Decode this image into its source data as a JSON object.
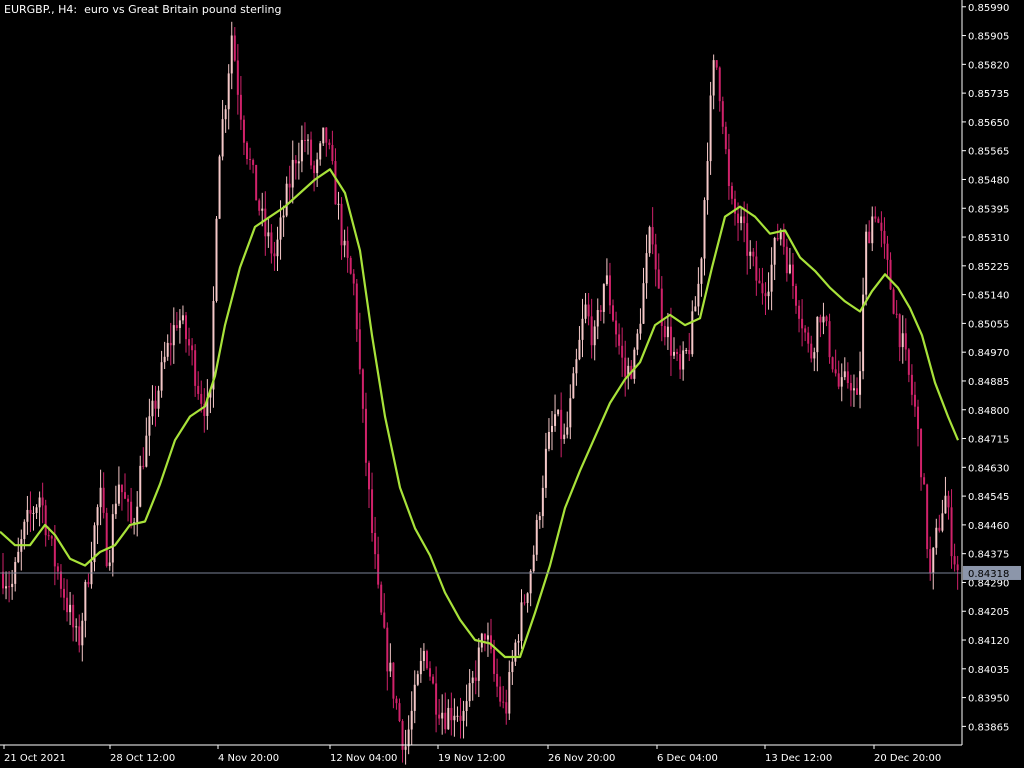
{
  "header": {
    "symbol": "EURGBP.,",
    "timeframe": "H4:",
    "description": "euro vs Great Britain pound sterling"
  },
  "colors": {
    "background": "#000000",
    "axis": "#ffffff",
    "bull_candle": "#f5c8c8",
    "bear_candle": "#d0226a",
    "moving_average": "#a8e23a",
    "last_price_line": "#7a8296",
    "last_price_badge": "#8c96aa"
  },
  "chart_data": {
    "type": "candlestick",
    "symbol": "EURGBP.",
    "timeframe": "H4",
    "ylim": [
      0.8381,
      0.8601
    ],
    "y_ticks": [
      "0.85990",
      "0.85905",
      "0.85820",
      "0.85735",
      "0.85650",
      "0.85565",
      "0.85480",
      "0.85395",
      "0.85310",
      "0.85225",
      "0.85140",
      "0.85055",
      "0.84970",
      "0.84885",
      "0.84800",
      "0.84715",
      "0.84630",
      "0.84545",
      "0.84460",
      "0.84375",
      "0.84290",
      "0.84205",
      "0.84120",
      "0.84035",
      "0.83950",
      "0.83865"
    ],
    "x_ticks": [
      "21 Oct 2021",
      "28 Oct 12:00",
      "4 Nov 20:00",
      "12 Nov 04:00",
      "19 Nov 12:00",
      "26 Nov 20:00",
      "6 Dec 04:00",
      "13 Dec 12:00",
      "20 Dec 20:00"
    ],
    "last_price": "0.84318",
    "price_path": [
      [
        0,
        0.8433
      ],
      [
        12,
        0.8428
      ],
      [
        25,
        0.8445
      ],
      [
        40,
        0.8455
      ],
      [
        52,
        0.8438
      ],
      [
        65,
        0.8425
      ],
      [
        78,
        0.841
      ],
      [
        92,
        0.844
      ],
      [
        100,
        0.8455
      ],
      [
        108,
        0.8435
      ],
      [
        118,
        0.846
      ],
      [
        132,
        0.8445
      ],
      [
        142,
        0.8465
      ],
      [
        152,
        0.8478
      ],
      [
        165,
        0.8495
      ],
      [
        178,
        0.8508
      ],
      [
        190,
        0.8498
      ],
      [
        200,
        0.8485
      ],
      [
        210,
        0.8478
      ],
      [
        218,
        0.8555
      ],
      [
        225,
        0.857
      ],
      [
        232,
        0.8592
      ],
      [
        238,
        0.8575
      ],
      [
        245,
        0.856
      ],
      [
        255,
        0.8545
      ],
      [
        265,
        0.8532
      ],
      [
        275,
        0.8525
      ],
      [
        285,
        0.854
      ],
      [
        295,
        0.8555
      ],
      [
        305,
        0.856
      ],
      [
        315,
        0.8548
      ],
      [
        325,
        0.8562
      ],
      [
        335,
        0.8545
      ],
      [
        345,
        0.8525
      ],
      [
        355,
        0.8515
      ],
      [
        362,
        0.848
      ],
      [
        370,
        0.845
      ],
      [
        378,
        0.8425
      ],
      [
        385,
        0.841
      ],
      [
        395,
        0.8395
      ],
      [
        405,
        0.838
      ],
      [
        415,
        0.8395
      ],
      [
        425,
        0.841
      ],
      [
        435,
        0.8395
      ],
      [
        445,
        0.839
      ],
      [
        455,
        0.8392
      ],
      [
        465,
        0.8389
      ],
      [
        475,
        0.8402
      ],
      [
        485,
        0.8415
      ],
      [
        495,
        0.84
      ],
      [
        505,
        0.839
      ],
      [
        515,
        0.841
      ],
      [
        525,
        0.8425
      ],
      [
        535,
        0.844
      ],
      [
        545,
        0.8465
      ],
      [
        555,
        0.8478
      ],
      [
        565,
        0.847
      ],
      [
        575,
        0.849
      ],
      [
        585,
        0.851
      ],
      [
        595,
        0.85
      ],
      [
        605,
        0.852
      ],
      [
        615,
        0.8505
      ],
      [
        625,
        0.849
      ],
      [
        635,
        0.8495
      ],
      [
        645,
        0.852
      ],
      [
        652,
        0.8535
      ],
      [
        660,
        0.851
      ],
      [
        670,
        0.85
      ],
      [
        680,
        0.849
      ],
      [
        690,
        0.85
      ],
      [
        700,
        0.852
      ],
      [
        708,
        0.856
      ],
      [
        715,
        0.8585
      ],
      [
        722,
        0.857
      ],
      [
        730,
        0.854
      ],
      [
        740,
        0.8535
      ],
      [
        750,
        0.8525
      ],
      [
        760,
        0.8515
      ],
      [
        770,
        0.852
      ],
      [
        780,
        0.8535
      ],
      [
        790,
        0.852
      ],
      [
        800,
        0.851
      ],
      [
        810,
        0.8495
      ],
      [
        820,
        0.851
      ],
      [
        830,
        0.8498
      ],
      [
        840,
        0.8485
      ],
      [
        850,
        0.849
      ],
      [
        858,
        0.848
      ],
      [
        866,
        0.853
      ],
      [
        875,
        0.854
      ],
      [
        885,
        0.8525
      ],
      [
        895,
        0.851
      ],
      [
        905,
        0.8495
      ],
      [
        915,
        0.848
      ],
      [
        922,
        0.8462
      ],
      [
        930,
        0.843
      ],
      [
        938,
        0.8445
      ],
      [
        945,
        0.8455
      ],
      [
        952,
        0.844
      ],
      [
        958,
        0.8432
      ]
    ],
    "moving_average": [
      [
        0,
        0.8444
      ],
      [
        15,
        0.844
      ],
      [
        30,
        0.844
      ],
      [
        45,
        0.8446
      ],
      [
        55,
        0.8443
      ],
      [
        70,
        0.8436
      ],
      [
        85,
        0.8434
      ],
      [
        100,
        0.8438
      ],
      [
        115,
        0.844
      ],
      [
        130,
        0.8446
      ],
      [
        145,
        0.8447
      ],
      [
        160,
        0.8458
      ],
      [
        175,
        0.8471
      ],
      [
        190,
        0.8478
      ],
      [
        205,
        0.8481
      ],
      [
        215,
        0.849
      ],
      [
        225,
        0.8505
      ],
      [
        240,
        0.8522
      ],
      [
        255,
        0.8534
      ],
      [
        270,
        0.8537
      ],
      [
        285,
        0.854
      ],
      [
        300,
        0.8544
      ],
      [
        315,
        0.8548
      ],
      [
        330,
        0.8551
      ],
      [
        345,
        0.8544
      ],
      [
        360,
        0.8527
      ],
      [
        372,
        0.8502
      ],
      [
        385,
        0.8478
      ],
      [
        400,
        0.8457
      ],
      [
        415,
        0.8445
      ],
      [
        430,
        0.8437
      ],
      [
        445,
        0.8426
      ],
      [
        460,
        0.8418
      ],
      [
        475,
        0.8412
      ],
      [
        490,
        0.8411
      ],
      [
        505,
        0.8407
      ],
      [
        520,
        0.8407
      ],
      [
        535,
        0.842
      ],
      [
        550,
        0.8434
      ],
      [
        565,
        0.8451
      ],
      [
        580,
        0.8462
      ],
      [
        595,
        0.8472
      ],
      [
        610,
        0.8482
      ],
      [
        625,
        0.8489
      ],
      [
        640,
        0.8494
      ],
      [
        655,
        0.8505
      ],
      [
        670,
        0.8508
      ],
      [
        685,
        0.8505
      ],
      [
        700,
        0.8507
      ],
      [
        712,
        0.8522
      ],
      [
        725,
        0.8537
      ],
      [
        740,
        0.854
      ],
      [
        755,
        0.8537
      ],
      [
        770,
        0.8532
      ],
      [
        785,
        0.8533
      ],
      [
        800,
        0.8525
      ],
      [
        815,
        0.8521
      ],
      [
        830,
        0.8516
      ],
      [
        845,
        0.8512
      ],
      [
        860,
        0.8509
      ],
      [
        872,
        0.8515
      ],
      [
        885,
        0.852
      ],
      [
        898,
        0.8516
      ],
      [
        910,
        0.851
      ],
      [
        922,
        0.8502
      ],
      [
        935,
        0.8488
      ],
      [
        948,
        0.8478
      ],
      [
        958,
        0.8471
      ]
    ]
  }
}
